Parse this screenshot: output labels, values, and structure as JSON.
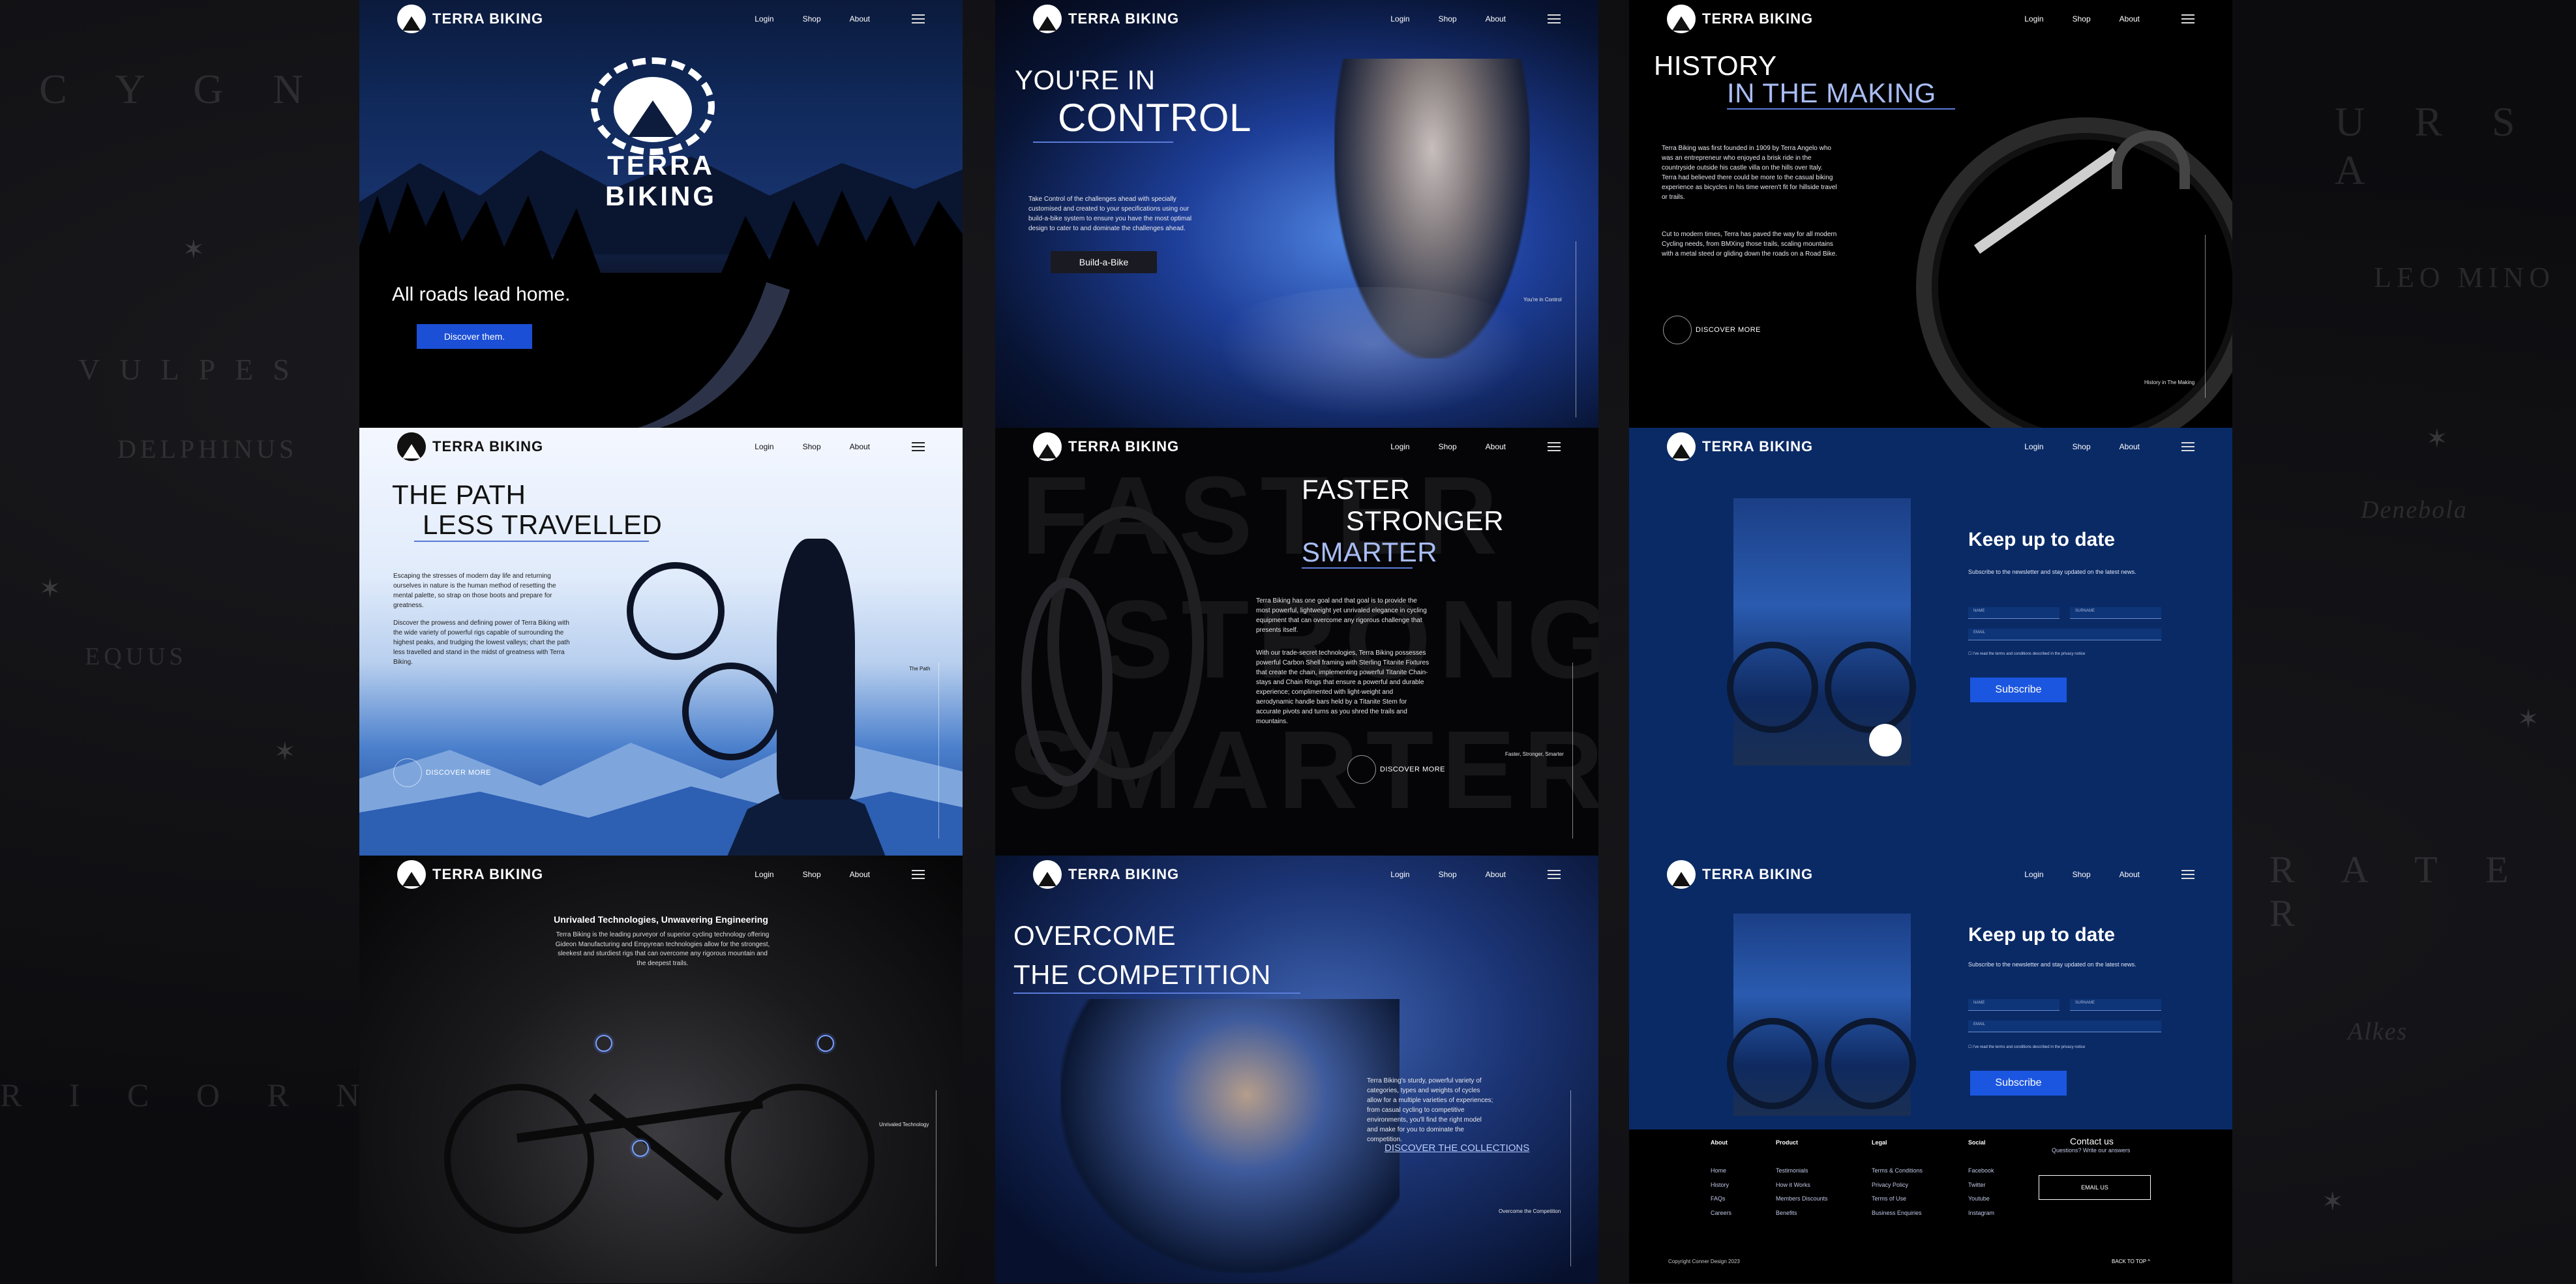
{
  "brand": "TERRA BIKING",
  "nav": {
    "login": "Login",
    "shop": "Shop",
    "about": "About"
  },
  "background": {
    "constellations": [
      "C Y G N",
      "VULPES",
      "DELPHINUS",
      "EQUUS",
      "R I C O R N U S",
      "U R S A",
      "LEO MINO",
      "Denebola",
      "R A T E R",
      "Alkes"
    ]
  },
  "panel1": {
    "logo_top": "TERRA",
    "logo_bottom": "BIKING",
    "tagline": "All roads lead home.",
    "cta": "Discover them."
  },
  "panel2": {
    "line1": "YOU'RE IN",
    "line2": "CONTROL",
    "body": "Take Control of the challenges ahead with specially customised and created to your specifications using our build-a-bike system to ensure you have the most optimal design to cater to and dominate the challenges ahead.",
    "cta": "Build-a-Bike",
    "side_caption": "You're in Control"
  },
  "panel3": {
    "line1": "HISTORY",
    "line2": "IN THE MAKING",
    "body1": "Terra Biking was first founded in 1909 by Terra Angelo who was an entrepreneur who enjoyed a brisk ride in the countryside outside his castle villa on the hills over Italy. Terra had believed there could be more to the casual biking experience as bicycles in his time weren't fit for hillside travel or trails.",
    "body2": "Cut to modern times, Terra has paved the way for all modern Cycling needs, from BMXing those trails, scaling mountains with a metal steed or gliding down the roads on a Road Bike.",
    "discover": "DISCOVER MORE",
    "side_caption": "History in The Making"
  },
  "panel4": {
    "line1": "THE PATH",
    "line2": "LESS TRAVELLED",
    "body1": "Escaping the stresses of modern day life and returning ourselves in nature is the human method of resetting the mental palette, so strap on those boots and prepare for greatness.",
    "body2": "Discover the prowess and defining power of Terra Biking with the wide variety of powerful rigs capable of surrounding the highest peaks, and trudging the lowest valleys; chart the path less travelled and stand in the midst of greatness with Terra Biking.",
    "discover": "DISCOVER MORE",
    "side_caption": "The Path"
  },
  "panel5": {
    "line1": "FASTER",
    "line2": "STRONGER",
    "line3": "SMARTER",
    "bg1": "FASTER",
    "bg2": "STRONGER",
    "bg3": "SMARTER",
    "body1": "Terra Biking has one goal and that goal is to provide the most powerful, lightweight yet unrivaled elegance in cycling equipment that can overcome any rigorous challenge that presents itself.",
    "body2": "With our trade-secret technologies, Terra Biking possesses powerful Carbon Shell framing with Sterling Titanite Fixtures that create the chain, implementing powerful Titanite Chain-stays and Chain Rings that ensure a powerful and durable experience; complimented with light-weight and aerodynamic handle bars held by a Titanite Stem for accurate pivots and turns as you shred the trails and mountains.",
    "discover": "DISCOVER MORE",
    "side_caption": "Faster, Stronger, Smarter"
  },
  "panel6": {
    "heading": "Keep up to date",
    "sub": "Subscribe to the newsletter and stay updated on the latest news.",
    "name_placeholder": "NAME",
    "surname_placeholder": "SURNAME",
    "email_placeholder": "EMAIL",
    "terms": "I've read the terms and conditions described in the privacy notice",
    "cta": "Subscribe",
    "badge": "TERRA BIKING"
  },
  "panel7": {
    "heading": "Unrivaled Technologies, Unwavering Engineering",
    "body": "Terra Biking is the leading purveyor of superior cycling technology offering Gideon Manufacturing and Empyrean technologies allow for the strongest, sleekest and sturdiest rigs that can overcome any rigorous mountain and the deepest trails.",
    "side_caption": "Unrivaled Technology"
  },
  "panel8": {
    "line1": "OVERCOME",
    "line2": "THE COMPETITION",
    "body": "Terra Biking's sturdy, powerful variety of categories, types and weights of cycles allow for a multiple varieties of experiences; from casual cycling to competitive environments, you'll find the right model and make for you to dominate the competition.",
    "link": "DISCOVER THE COLLECTIONS",
    "side_caption": "Overcome the Competition"
  },
  "panel9": {
    "heading": "Keep up to date",
    "sub": "Subscribe to the newsletter and stay updated on the latest news.",
    "name_placeholder": "NAME",
    "surname_placeholder": "SURNAME",
    "email_placeholder": "EMAIL",
    "terms": "I've read the terms and conditions described in the privacy notice",
    "cta": "Subscribe",
    "footer": {
      "about": {
        "title": "About",
        "items": [
          "Home",
          "History",
          "FAQs",
          "Careers"
        ]
      },
      "product": {
        "title": "Product",
        "items": [
          "Testimonials",
          "How it Works",
          "Members Discounts",
          "Benefits"
        ]
      },
      "legal": {
        "title": "Legal",
        "items": [
          "Terms & Conditions",
          "Privacy Policy",
          "Terms of Use",
          "Business Enquiries"
        ]
      },
      "social": {
        "title": "Social",
        "items": [
          "Facebook",
          "Twitter",
          "Youtube",
          "Instagram"
        ]
      },
      "contact_title": "Contact us",
      "contact_sub": "Questions? Write our answers",
      "email_btn": "EMAIL US",
      "copyright": "Copyright Conner Design 2023",
      "back_to_top": "BACK TO TOP ^"
    }
  }
}
